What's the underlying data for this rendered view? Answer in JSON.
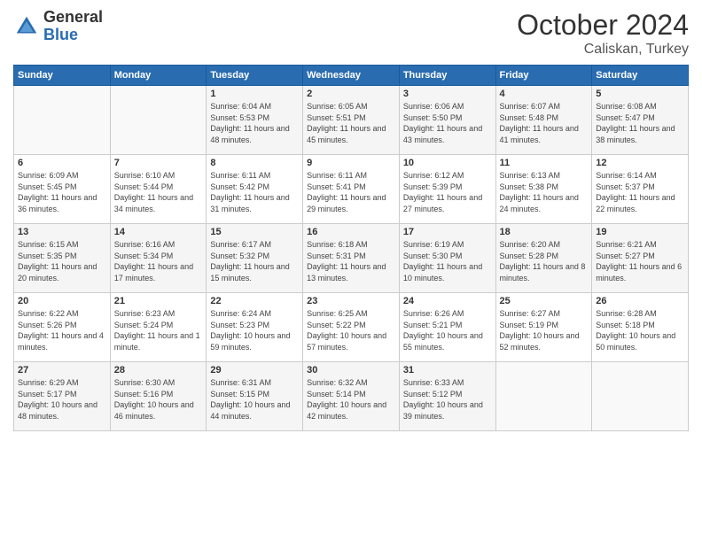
{
  "header": {
    "logo_general": "General",
    "logo_blue": "Blue",
    "title": "October 2024",
    "location": "Caliskan, Turkey"
  },
  "weekdays": [
    "Sunday",
    "Monday",
    "Tuesday",
    "Wednesday",
    "Thursday",
    "Friday",
    "Saturday"
  ],
  "weeks": [
    [
      {
        "day": "",
        "info": ""
      },
      {
        "day": "",
        "info": ""
      },
      {
        "day": "1",
        "info": "Sunrise: 6:04 AM\nSunset: 5:53 PM\nDaylight: 11 hours and 48 minutes."
      },
      {
        "day": "2",
        "info": "Sunrise: 6:05 AM\nSunset: 5:51 PM\nDaylight: 11 hours and 45 minutes."
      },
      {
        "day": "3",
        "info": "Sunrise: 6:06 AM\nSunset: 5:50 PM\nDaylight: 11 hours and 43 minutes."
      },
      {
        "day": "4",
        "info": "Sunrise: 6:07 AM\nSunset: 5:48 PM\nDaylight: 11 hours and 41 minutes."
      },
      {
        "day": "5",
        "info": "Sunrise: 6:08 AM\nSunset: 5:47 PM\nDaylight: 11 hours and 38 minutes."
      }
    ],
    [
      {
        "day": "6",
        "info": "Sunrise: 6:09 AM\nSunset: 5:45 PM\nDaylight: 11 hours and 36 minutes."
      },
      {
        "day": "7",
        "info": "Sunrise: 6:10 AM\nSunset: 5:44 PM\nDaylight: 11 hours and 34 minutes."
      },
      {
        "day": "8",
        "info": "Sunrise: 6:11 AM\nSunset: 5:42 PM\nDaylight: 11 hours and 31 minutes."
      },
      {
        "day": "9",
        "info": "Sunrise: 6:11 AM\nSunset: 5:41 PM\nDaylight: 11 hours and 29 minutes."
      },
      {
        "day": "10",
        "info": "Sunrise: 6:12 AM\nSunset: 5:39 PM\nDaylight: 11 hours and 27 minutes."
      },
      {
        "day": "11",
        "info": "Sunrise: 6:13 AM\nSunset: 5:38 PM\nDaylight: 11 hours and 24 minutes."
      },
      {
        "day": "12",
        "info": "Sunrise: 6:14 AM\nSunset: 5:37 PM\nDaylight: 11 hours and 22 minutes."
      }
    ],
    [
      {
        "day": "13",
        "info": "Sunrise: 6:15 AM\nSunset: 5:35 PM\nDaylight: 11 hours and 20 minutes."
      },
      {
        "day": "14",
        "info": "Sunrise: 6:16 AM\nSunset: 5:34 PM\nDaylight: 11 hours and 17 minutes."
      },
      {
        "day": "15",
        "info": "Sunrise: 6:17 AM\nSunset: 5:32 PM\nDaylight: 11 hours and 15 minutes."
      },
      {
        "day": "16",
        "info": "Sunrise: 6:18 AM\nSunset: 5:31 PM\nDaylight: 11 hours and 13 minutes."
      },
      {
        "day": "17",
        "info": "Sunrise: 6:19 AM\nSunset: 5:30 PM\nDaylight: 11 hours and 10 minutes."
      },
      {
        "day": "18",
        "info": "Sunrise: 6:20 AM\nSunset: 5:28 PM\nDaylight: 11 hours and 8 minutes."
      },
      {
        "day": "19",
        "info": "Sunrise: 6:21 AM\nSunset: 5:27 PM\nDaylight: 11 hours and 6 minutes."
      }
    ],
    [
      {
        "day": "20",
        "info": "Sunrise: 6:22 AM\nSunset: 5:26 PM\nDaylight: 11 hours and 4 minutes."
      },
      {
        "day": "21",
        "info": "Sunrise: 6:23 AM\nSunset: 5:24 PM\nDaylight: 11 hours and 1 minute."
      },
      {
        "day": "22",
        "info": "Sunrise: 6:24 AM\nSunset: 5:23 PM\nDaylight: 10 hours and 59 minutes."
      },
      {
        "day": "23",
        "info": "Sunrise: 6:25 AM\nSunset: 5:22 PM\nDaylight: 10 hours and 57 minutes."
      },
      {
        "day": "24",
        "info": "Sunrise: 6:26 AM\nSunset: 5:21 PM\nDaylight: 10 hours and 55 minutes."
      },
      {
        "day": "25",
        "info": "Sunrise: 6:27 AM\nSunset: 5:19 PM\nDaylight: 10 hours and 52 minutes."
      },
      {
        "day": "26",
        "info": "Sunrise: 6:28 AM\nSunset: 5:18 PM\nDaylight: 10 hours and 50 minutes."
      }
    ],
    [
      {
        "day": "27",
        "info": "Sunrise: 6:29 AM\nSunset: 5:17 PM\nDaylight: 10 hours and 48 minutes."
      },
      {
        "day": "28",
        "info": "Sunrise: 6:30 AM\nSunset: 5:16 PM\nDaylight: 10 hours and 46 minutes."
      },
      {
        "day": "29",
        "info": "Sunrise: 6:31 AM\nSunset: 5:15 PM\nDaylight: 10 hours and 44 minutes."
      },
      {
        "day": "30",
        "info": "Sunrise: 6:32 AM\nSunset: 5:14 PM\nDaylight: 10 hours and 42 minutes."
      },
      {
        "day": "31",
        "info": "Sunrise: 6:33 AM\nSunset: 5:12 PM\nDaylight: 10 hours and 39 minutes."
      },
      {
        "day": "",
        "info": ""
      },
      {
        "day": "",
        "info": ""
      }
    ]
  ]
}
